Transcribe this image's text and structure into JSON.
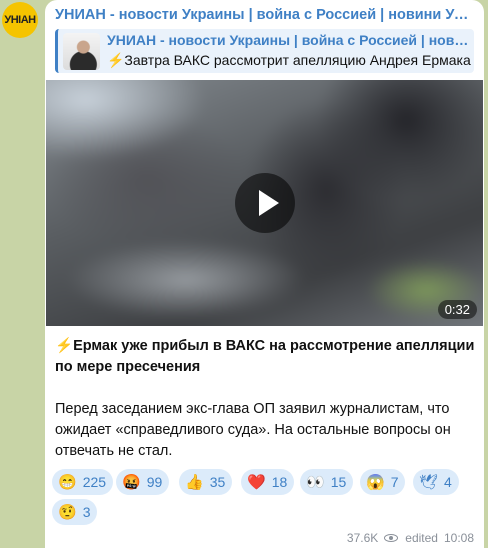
{
  "channel": {
    "avatar_text": "УНІАН",
    "name": "УНИАН - новости Украины | война с Россией | новини України"
  },
  "reply": {
    "title": "УНИАН - новости Украины | война с Россией | новини України",
    "text": "⚡Завтра ВАКС рассмотрит апелляцию Андрея Ермака"
  },
  "video": {
    "duration": "0:32"
  },
  "post": {
    "title_icon": "⚡",
    "title": "Ермак уже прибыл в ВАКС на рассмотрение апелляции по мере пресечения",
    "body": "Перед заседанием экс-глава ОП заявил журналистам, что ожидает «справедливого суда». На остальные вопросы он отвечать не стал."
  },
  "reactions": [
    {
      "emoji": "😁",
      "count": "225"
    },
    {
      "emoji": "🤬",
      "count": "99"
    },
    {
      "emoji": "👍",
      "count": "35"
    },
    {
      "emoji": "❤️",
      "count": "18"
    },
    {
      "emoji": "👀",
      "count": "15"
    },
    {
      "emoji": "😱",
      "count": "7"
    },
    {
      "emoji": "🕊",
      "count": "4"
    },
    {
      "emoji": "🤨",
      "count": "3"
    }
  ],
  "meta": {
    "views": "37.6K",
    "edited_label": "edited",
    "time": "10:08"
  },
  "colors": {
    "accent": "#3f80c5",
    "reaction_bg": "#dcebfa",
    "chat_bg": "#c8d4a6"
  }
}
